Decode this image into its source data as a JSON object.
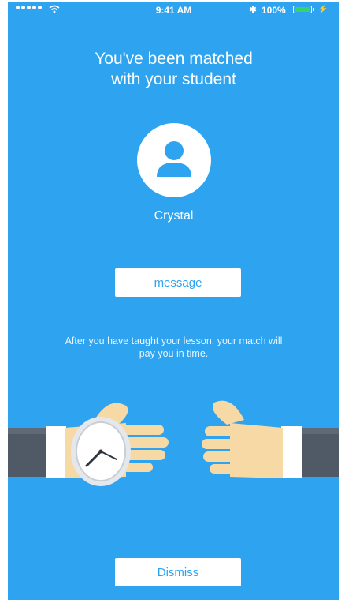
{
  "status_bar": {
    "time": "9:41 AM",
    "battery": "100%",
    "bluetooth_glyph": "✱",
    "charge_glyph": "⚡"
  },
  "match": {
    "title_line1": "You've been matched",
    "title_line2": "with your student",
    "student_name": "Crystal",
    "message_label": "message",
    "info_text": "After you have taught your lesson, your match will pay you in time.",
    "dismiss_label": "Dismiss"
  },
  "icons": {
    "avatar": "person-icon",
    "signal": "signal-dots-icon",
    "wifi": "wifi-icon",
    "bluetooth": "bluetooth-icon",
    "battery": "battery-icon",
    "illustration": "hands-watch-illustration"
  },
  "colors": {
    "background": "#2ea3ef",
    "button_bg": "#ffffff",
    "button_text": "#2ea3ef",
    "skin": "#f7d9a6",
    "sleeve": "#4f5a66",
    "battery_fill": "#36d36b"
  }
}
